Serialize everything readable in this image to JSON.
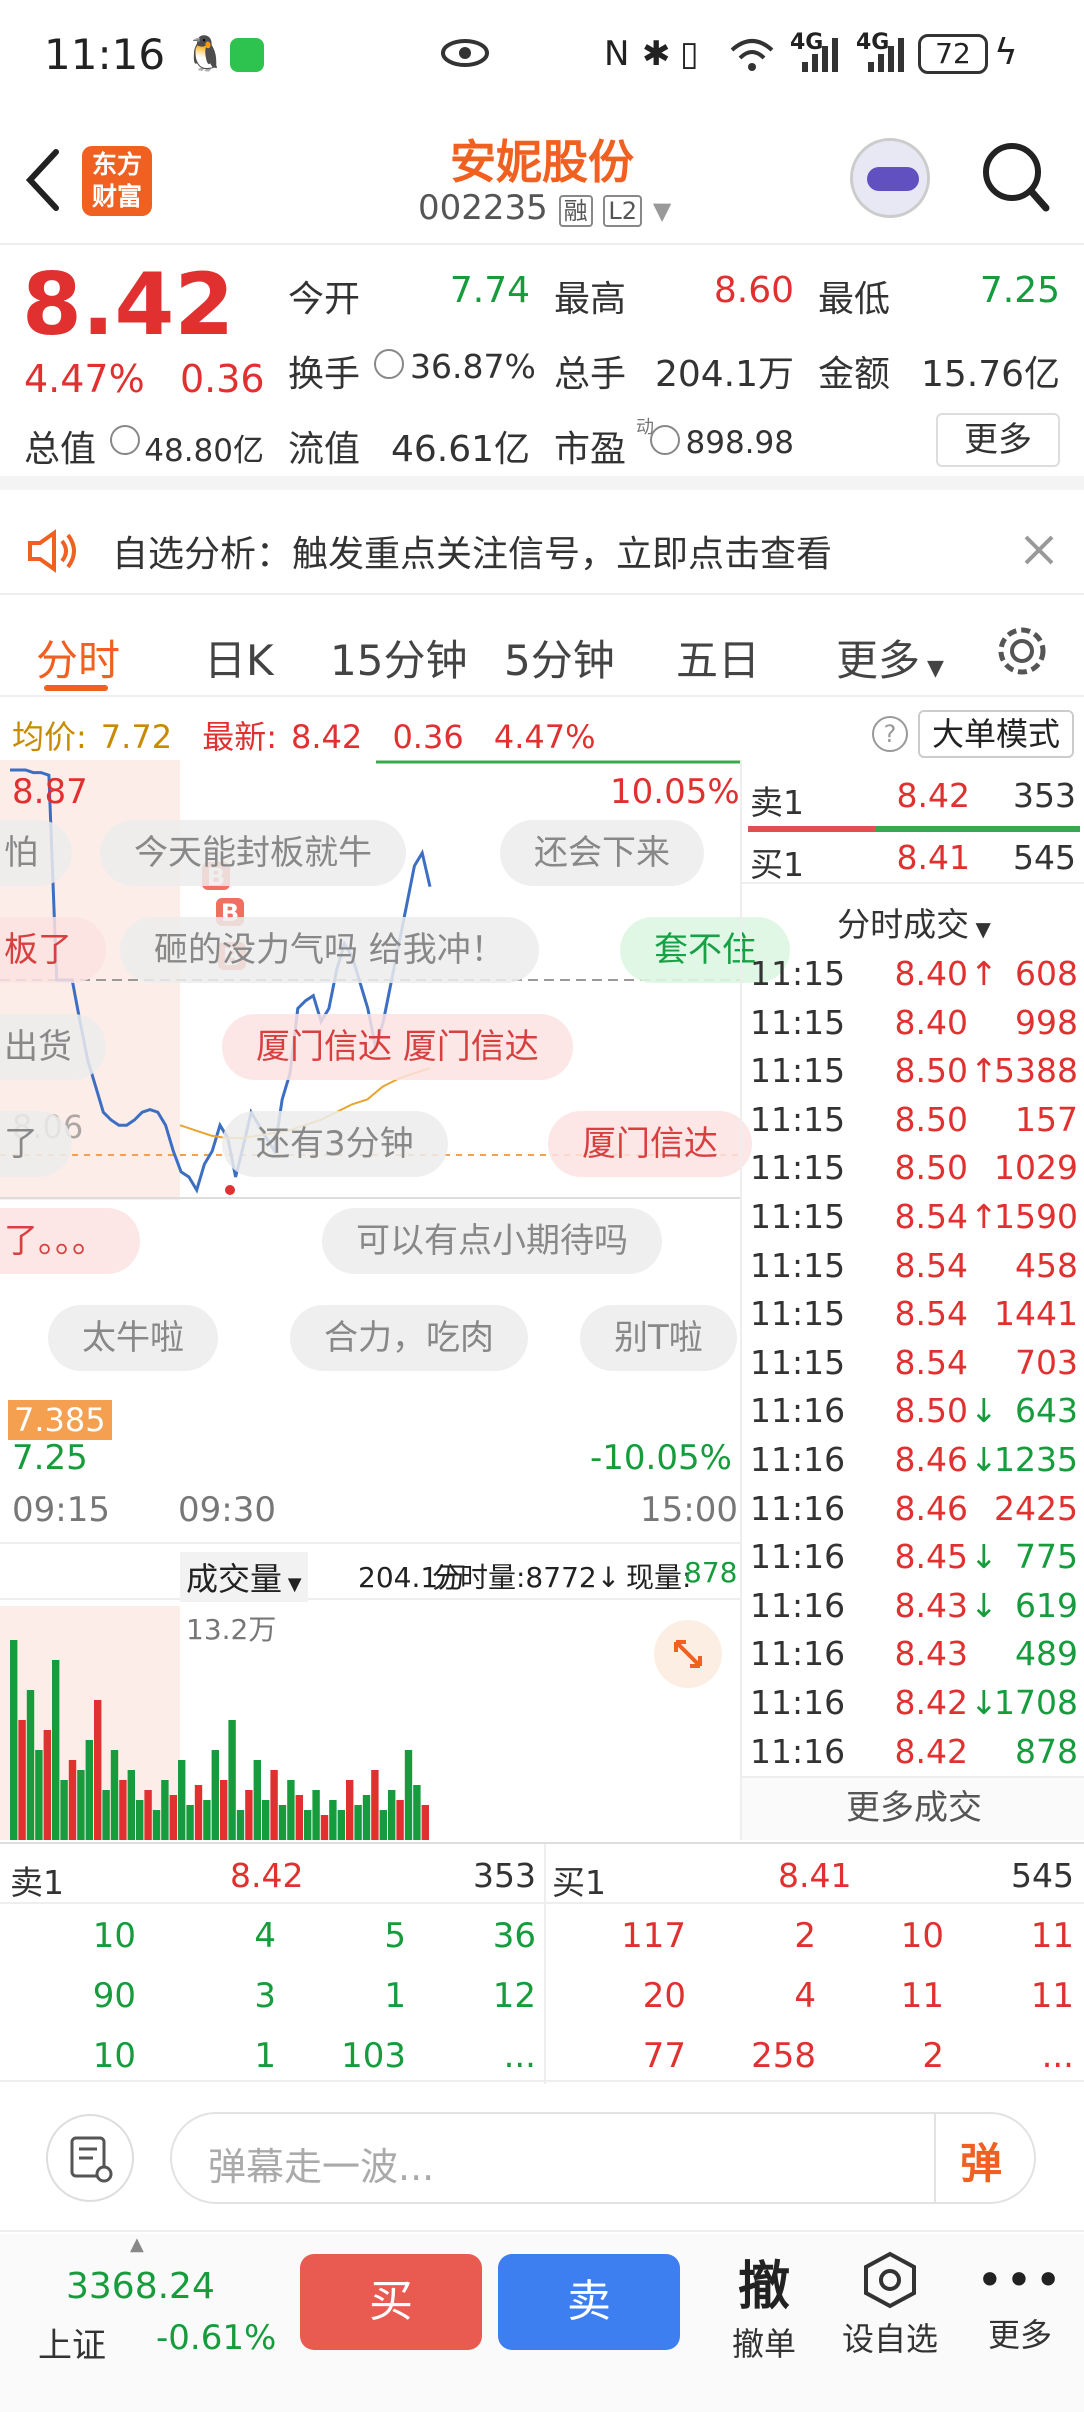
{
  "status": {
    "time": "11:16",
    "battery": "72",
    "signal1": "4G",
    "signal2": "4G"
  },
  "header": {
    "logo_line1": "东方",
    "logo_line2": "财富",
    "stock_name": "安妮股份",
    "stock_code": "002235",
    "tag1": "融",
    "tag2": "L2"
  },
  "quote": {
    "price": "8.42",
    "change_pct": "4.47%",
    "change": "0.36",
    "open_label": "今开",
    "open": "7.74",
    "high_label": "最高",
    "high": "8.60",
    "low_label": "最低",
    "low": "7.25",
    "turnover_label": "换手",
    "turnover": "36.87%",
    "volume_label": "总手",
    "volume": "204.1万",
    "amount_label": "金额",
    "amount": "15.76亿",
    "mcap_label": "总值",
    "mcap": "48.80亿",
    "float_label": "流值",
    "float": "46.61亿",
    "pe_label": "市盈",
    "pe_sup": "动",
    "pe": "898.98",
    "more": "更多"
  },
  "alert": {
    "text": "自选分析：触发重点关注信号，立即点击查看"
  },
  "tabs": [
    "分时",
    "日K",
    "15分钟",
    "5分钟",
    "五日",
    "更多"
  ],
  "chart_info": {
    "avg_label": "均价:",
    "avg": "7.72",
    "last_label": "最新:",
    "last": "8.42",
    "chg": "0.36",
    "pct": "4.47%",
    "mode": "大单模式"
  },
  "chart_data": {
    "type": "line",
    "price_high_label": "8.87",
    "price_mid_label": "8.06",
    "price_low_label": "7.25",
    "price_mark": "7.385",
    "pct_high_label": "10.05%",
    "pct_low_label": "-10.05%",
    "ylim": [
      7.25,
      8.87
    ],
    "time_labels": [
      "09:15",
      "09:30",
      "15:00"
    ],
    "price_series": [
      8.87,
      8.87,
      8.87,
      8.86,
      8.86,
      8.85,
      8.06,
      8.06,
      8.06,
      7.9,
      7.75,
      7.65,
      7.55,
      7.52,
      7.5,
      7.5,
      7.52,
      7.55,
      7.56,
      7.55,
      7.5,
      7.4,
      7.32,
      7.3,
      7.25,
      7.35,
      7.4,
      7.5,
      7.45,
      7.3,
      7.42,
      7.55,
      7.5,
      7.45,
      7.4,
      7.6,
      7.7,
      7.95,
      7.98,
      8.0,
      7.9,
      7.95,
      8.1,
      8.2,
      8.15,
      8.05,
      7.95,
      7.8,
      7.9,
      8.05,
      8.2,
      8.35,
      8.5,
      8.55,
      8.42
    ],
    "avg_series": [
      7.5,
      7.48,
      7.46,
      7.45,
      7.45,
      7.46,
      7.47,
      7.48,
      7.5,
      7.52,
      7.55,
      7.58,
      7.6,
      7.65,
      7.68,
      7.7,
      7.72
    ],
    "volume_label": "成交量",
    "volume_total": "204.1万",
    "volume_max": "13.2万",
    "minute_vol": "分时量:8772↓",
    "current_vol_label": "现量:",
    "current_vol": "878"
  },
  "danmaku": [
    {
      "text": "今天能封板就牛",
      "c": ""
    },
    {
      "text": "还会下来",
      "c": ""
    },
    {
      "text": "怕",
      "c": ""
    },
    {
      "text": "砸的没力气吗 给我冲！",
      "c": ""
    },
    {
      "text": "套不住",
      "c": "g"
    },
    {
      "text": "板了",
      "c": "r"
    },
    {
      "text": "厦门信达 厦门信达",
      "c": "r"
    },
    {
      "text": "出货",
      "c": ""
    },
    {
      "text": "还有3分钟",
      "c": ""
    },
    {
      "text": "厦门信达",
      "c": "r"
    },
    {
      "text": "了",
      "c": ""
    },
    {
      "text": "可以有点小期待吗",
      "c": ""
    },
    {
      "text": "了。。。",
      "c": "r"
    },
    {
      "text": "太牛啦",
      "c": ""
    },
    {
      "text": "合力，吃肉",
      "c": ""
    },
    {
      "text": "别T啦",
      "c": ""
    }
  ],
  "book_top": {
    "sell_label": "卖1",
    "sell_price": "8.42",
    "sell_vol": "353",
    "buy_label": "买1",
    "buy_price": "8.41",
    "buy_vol": "545"
  },
  "trades_title": "分时成交",
  "trades": [
    {
      "t": "11:15",
      "p": "8.40",
      "a": "↑",
      "v": "608",
      "c": "red"
    },
    {
      "t": "11:15",
      "p": "8.40",
      "a": "",
      "v": "998",
      "c": "red"
    },
    {
      "t": "11:15",
      "p": "8.50",
      "a": "↑",
      "v": "5388",
      "c": "red"
    },
    {
      "t": "11:15",
      "p": "8.50",
      "a": "",
      "v": "157",
      "c": "red"
    },
    {
      "t": "11:15",
      "p": "8.50",
      "a": "",
      "v": "1029",
      "c": "red"
    },
    {
      "t": "11:15",
      "p": "8.54",
      "a": "↑",
      "v": "1590",
      "c": "red"
    },
    {
      "t": "11:15",
      "p": "8.54",
      "a": "",
      "v": "458",
      "c": "red"
    },
    {
      "t": "11:15",
      "p": "8.54",
      "a": "",
      "v": "1441",
      "c": "red"
    },
    {
      "t": "11:15",
      "p": "8.54",
      "a": "",
      "v": "703",
      "c": "red"
    },
    {
      "t": "11:16",
      "p": "8.50",
      "a": "↓",
      "v": "643",
      "c": "green"
    },
    {
      "t": "11:16",
      "p": "8.46",
      "a": "↓",
      "v": "1235",
      "c": "green"
    },
    {
      "t": "11:16",
      "p": "8.46",
      "a": "",
      "v": "2425",
      "c": "red"
    },
    {
      "t": "11:16",
      "p": "8.45",
      "a": "↓",
      "v": "775",
      "c": "green"
    },
    {
      "t": "11:16",
      "p": "8.43",
      "a": "↓",
      "v": "619",
      "c": "green"
    },
    {
      "t": "11:16",
      "p": "8.43",
      "a": "",
      "v": "489",
      "c": "green"
    },
    {
      "t": "11:16",
      "p": "8.42",
      "a": "↓",
      "v": "1708",
      "c": "green"
    },
    {
      "t": "11:16",
      "p": "8.42",
      "a": "",
      "v": "878",
      "c": "green"
    }
  ],
  "more_trades": "更多成交",
  "depth": {
    "sell_label": "卖1",
    "sell_price": "8.42",
    "sell_vol": "353",
    "buy_label": "买1",
    "buy_price": "8.41",
    "buy_vol": "545",
    "sell_rows": [
      [
        "10",
        "4",
        "5",
        "36"
      ],
      [
        "90",
        "3",
        "1",
        "12"
      ],
      [
        "10",
        "1",
        "103",
        "..."
      ]
    ],
    "buy_rows": [
      [
        "117",
        "2",
        "10",
        "11"
      ],
      [
        "20",
        "4",
        "11",
        "11"
      ],
      [
        "77",
        "258",
        "2",
        "..."
      ]
    ]
  },
  "danmaku_input": {
    "placeholder": "弹幕走一波...",
    "send": "弹"
  },
  "bottom": {
    "index_value": "3368.24",
    "index_name": "上证",
    "index_change": "-0.61%",
    "buy": "买",
    "sell": "卖",
    "cancel_icon": "撤",
    "cancel": "撤单",
    "watch": "设自选",
    "more": "更多"
  }
}
